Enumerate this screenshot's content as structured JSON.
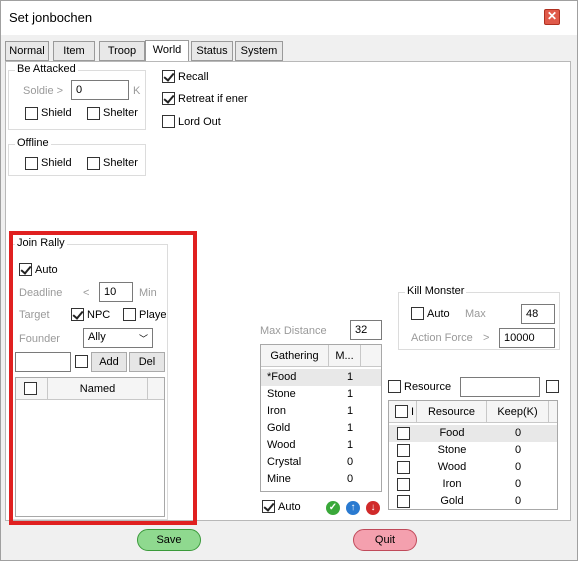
{
  "title": "Set jonbochen",
  "tabs": [
    "Normal",
    "Item",
    "Troop",
    "World",
    "Status",
    "System"
  ],
  "be_attacked": {
    "title": "Be Attacked",
    "soldier_label": "Soldie >",
    "soldier_value": "0",
    "soldier_unit": "K",
    "shield": "Shield",
    "shelter": "Shelter"
  },
  "right_opts": {
    "recall": "Recall",
    "retreat": "Retreat if ener",
    "lord_out": "Lord Out"
  },
  "offline": {
    "title": "Offline",
    "shield": "Shield",
    "shelter": "Shelter"
  },
  "join_rally": {
    "title": "Join Rally",
    "auto": "Auto",
    "deadline_label": "Deadline",
    "deadline_op": "<",
    "deadline_value": "10",
    "deadline_unit": "Min",
    "target_label": "Target",
    "npc": "NPC",
    "player": "Playe",
    "founder_label": "Founder",
    "founder_value": "Ally",
    "add_button": "Add",
    "del_button": "Del",
    "table_header": "Named"
  },
  "kill_monster": {
    "title": "Kill Monster",
    "auto": "Auto",
    "max_label": "Max",
    "max_value": "48",
    "force_label": "Action Force",
    "force_op": ">",
    "force_value": "10000"
  },
  "gathering": {
    "max_distance_label": "Max Distance",
    "max_distance_value": "32",
    "col_gathering": "Gathering",
    "col_m": "M...",
    "rows": [
      {
        "name": "*Food",
        "value": "1"
      },
      {
        "name": "Stone",
        "value": "1"
      },
      {
        "name": "Iron",
        "value": "1"
      },
      {
        "name": "Gold",
        "value": "1"
      },
      {
        "name": "Wood",
        "value": "1"
      },
      {
        "name": "Crystal",
        "value": "0"
      },
      {
        "name": "Mine",
        "value": "0"
      }
    ],
    "auto": "Auto"
  },
  "resource": {
    "label": "Resource",
    "col_i": "I",
    "col_resource": "Resource",
    "col_keep": "Keep(K)",
    "rows": [
      {
        "name": "Food",
        "keep": "0"
      },
      {
        "name": "Stone",
        "keep": "0"
      },
      {
        "name": "Wood",
        "keep": "0"
      },
      {
        "name": "Iron",
        "keep": "0"
      },
      {
        "name": "Gold",
        "keep": "0"
      }
    ]
  },
  "footer": {
    "save": "Save",
    "quit": "Quit"
  },
  "colors": {
    "highlight": "#e02020",
    "save": "#7fd07f",
    "quit": "#f08a9a"
  }
}
